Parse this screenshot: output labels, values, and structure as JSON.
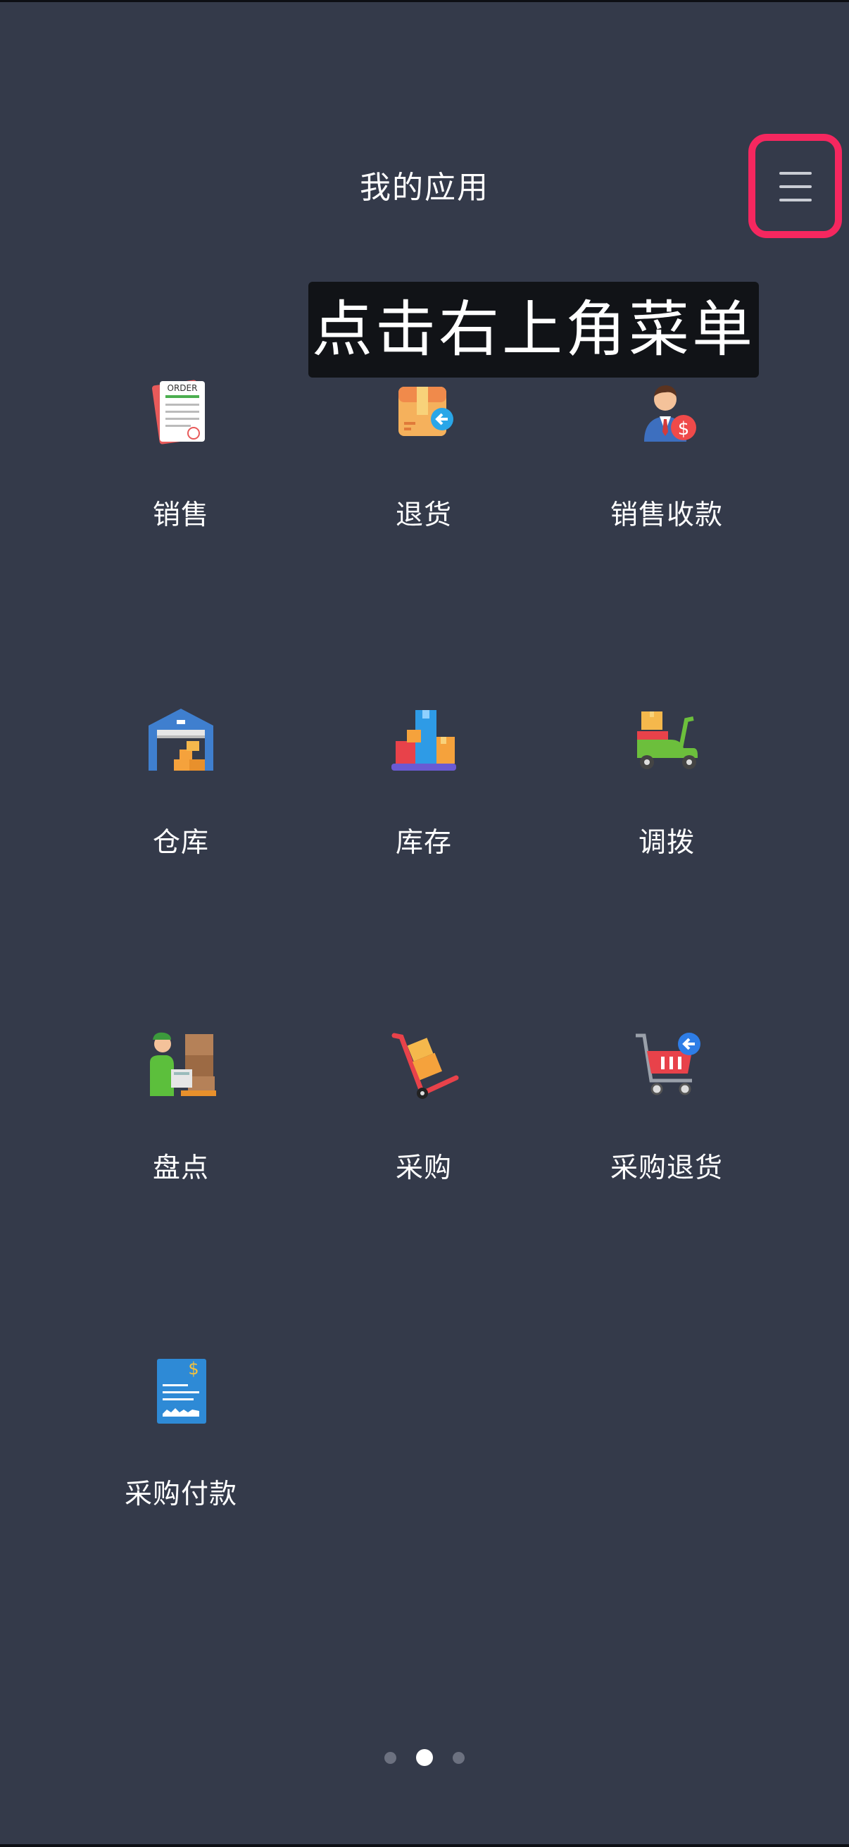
{
  "header": {
    "title": "我的应用",
    "menu_icon": "hamburger-menu-icon"
  },
  "tip": {
    "text": "点击右上角菜单",
    "highlight_color": "#f5275f"
  },
  "apps": [
    {
      "label": "销售",
      "icon": "order-document-icon"
    },
    {
      "label": "退货",
      "icon": "return-box-icon"
    },
    {
      "label": "销售收款",
      "icon": "businessman-money-icon"
    },
    {
      "label": "仓库",
      "icon": "warehouse-icon"
    },
    {
      "label": "库存",
      "icon": "inventory-boxes-icon"
    },
    {
      "label": "调拨",
      "icon": "delivery-scooter-icon"
    },
    {
      "label": "盘点",
      "icon": "stocktaking-worker-icon"
    },
    {
      "label": "采购",
      "icon": "hand-truck-icon"
    },
    {
      "label": "采购退货",
      "icon": "cart-return-icon"
    },
    {
      "label": "采购付款",
      "icon": "payment-document-icon"
    }
  ],
  "pager": {
    "total": 3,
    "active_index": 1
  },
  "colors": {
    "background": "#343a4a",
    "tip_background": "#111317",
    "highlight": "#f5275f"
  }
}
